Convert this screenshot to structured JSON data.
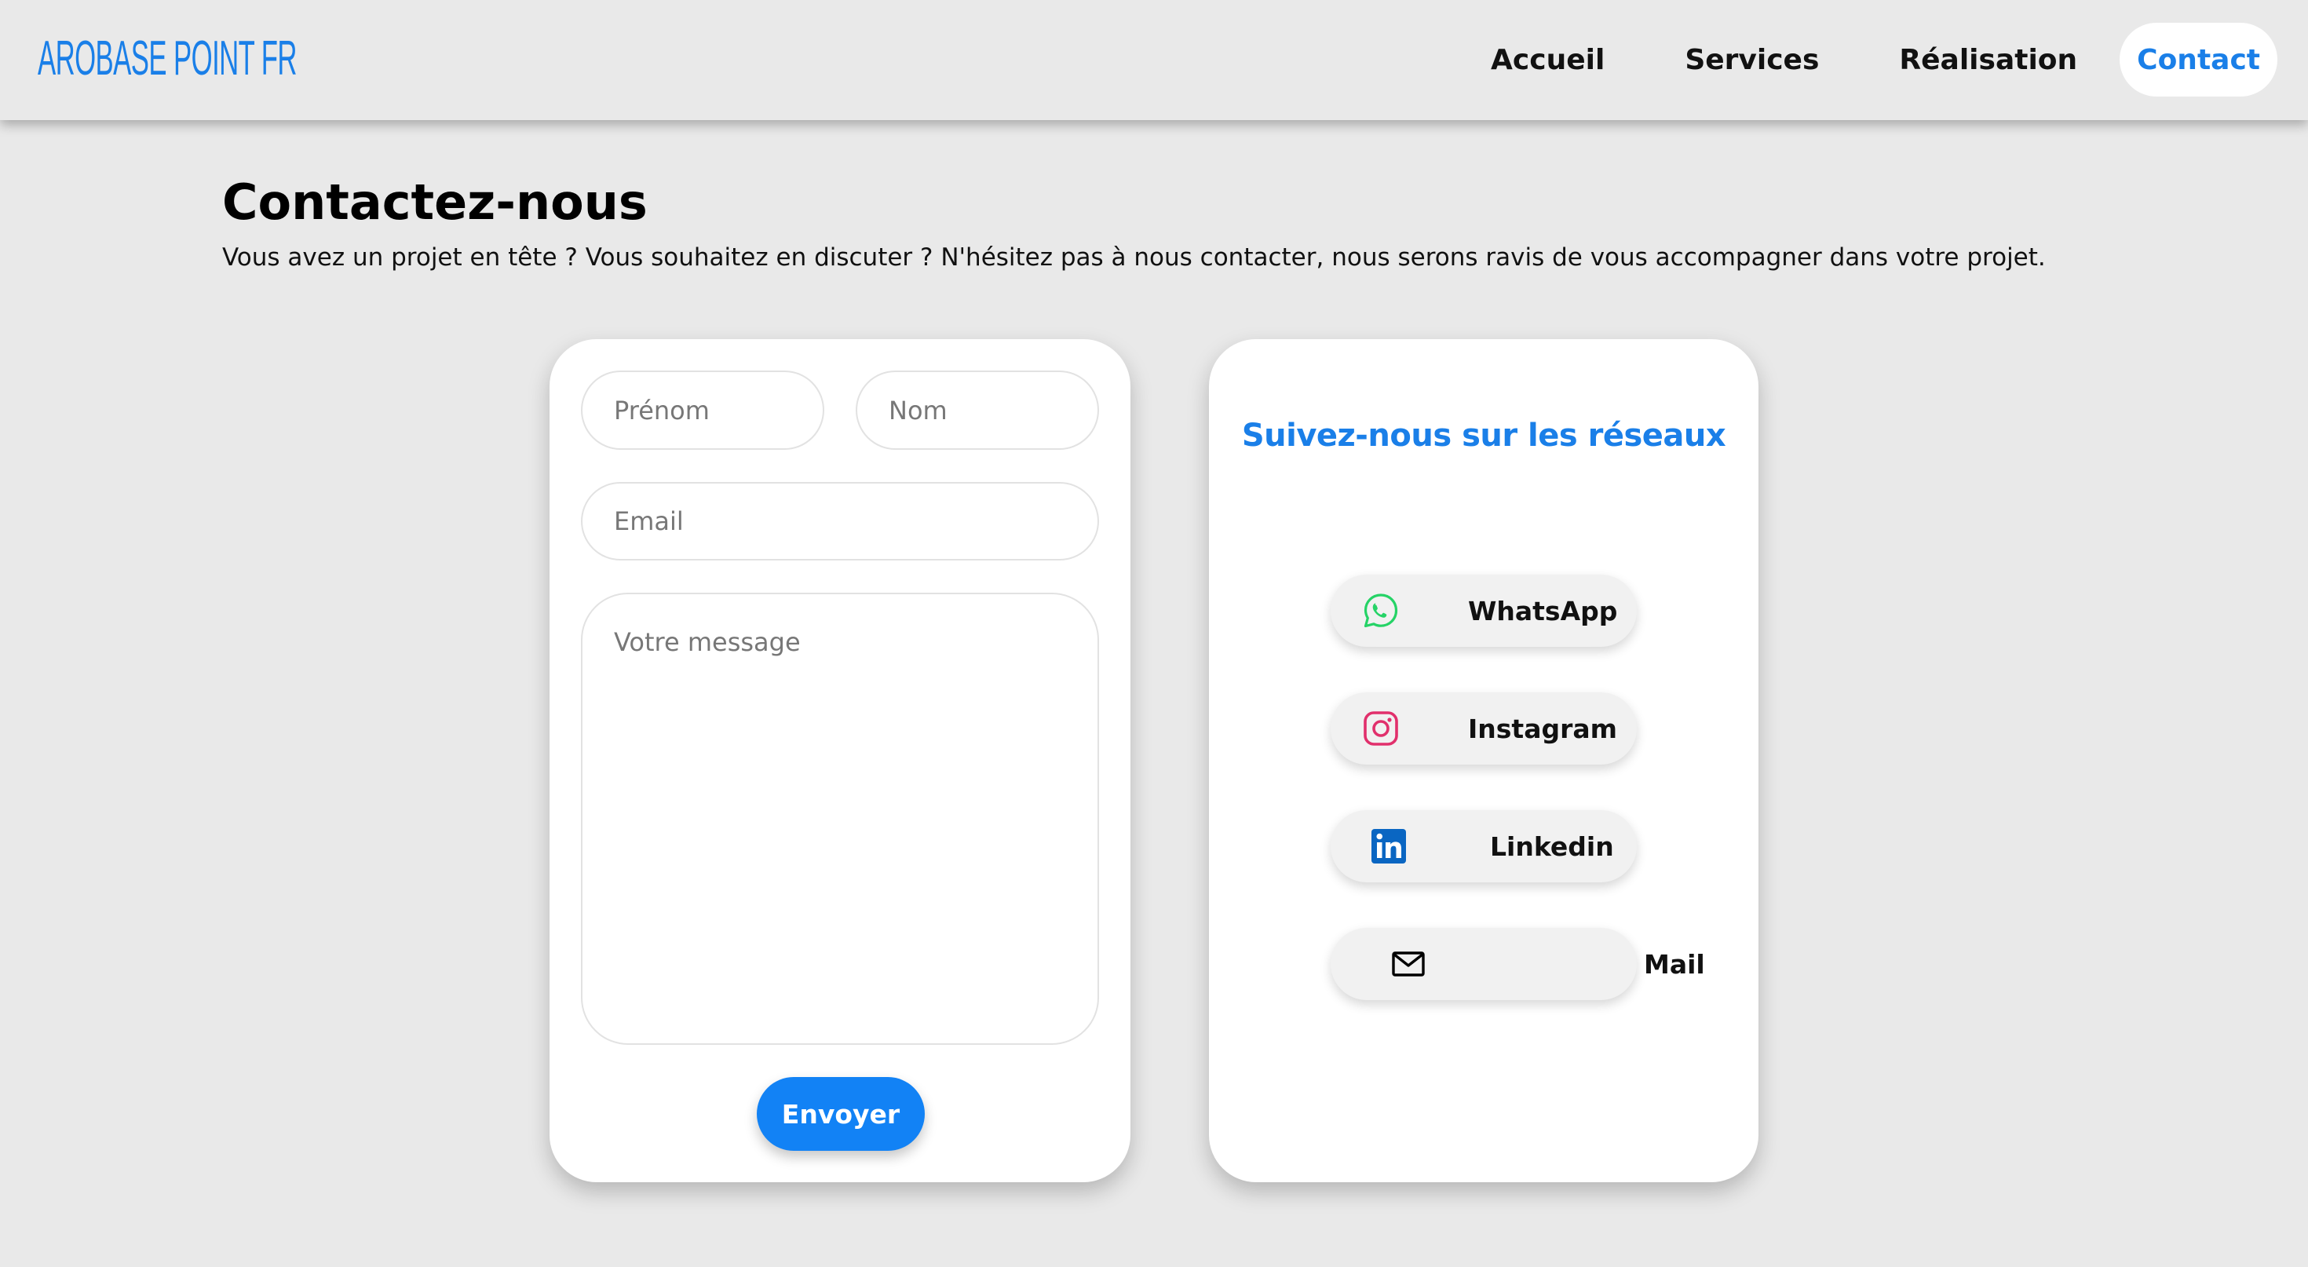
{
  "brand": {
    "logo_text": "AROBASE POINT FR",
    "accent_color": "#1a7fe8"
  },
  "nav": {
    "items": [
      {
        "label": "Accueil",
        "active": false
      },
      {
        "label": "Services",
        "active": false
      },
      {
        "label": "Réalisation",
        "active": false
      },
      {
        "label": "Contact",
        "active": true
      }
    ]
  },
  "intro": {
    "title": "Contactez-nous",
    "description": "Vous avez un projet en tête ? Vous souhaitez en discuter ? N'hésitez pas à nous contacter, nous serons ravis de vous accompagner dans votre projet."
  },
  "form": {
    "first_name": {
      "placeholder": "Prénom",
      "value": ""
    },
    "last_name": {
      "placeholder": "Nom",
      "value": ""
    },
    "email": {
      "placeholder": "Email",
      "value": ""
    },
    "message": {
      "placeholder": "Votre message",
      "value": ""
    },
    "submit_label": "Envoyer",
    "submit_color": "#1282f5"
  },
  "social": {
    "title": "Suivez-nous sur les réseaux",
    "links": [
      {
        "label": "WhatsApp",
        "icon": "whatsapp-icon",
        "color": "#25d366"
      },
      {
        "label": "Instagram",
        "icon": "instagram-icon",
        "color": "#e1306c"
      },
      {
        "label": "Linkedin",
        "icon": "linkedin-icon",
        "color": "#0a66c2"
      },
      {
        "label": "Mail",
        "icon": "mail-icon",
        "color": "#000000"
      }
    ]
  }
}
